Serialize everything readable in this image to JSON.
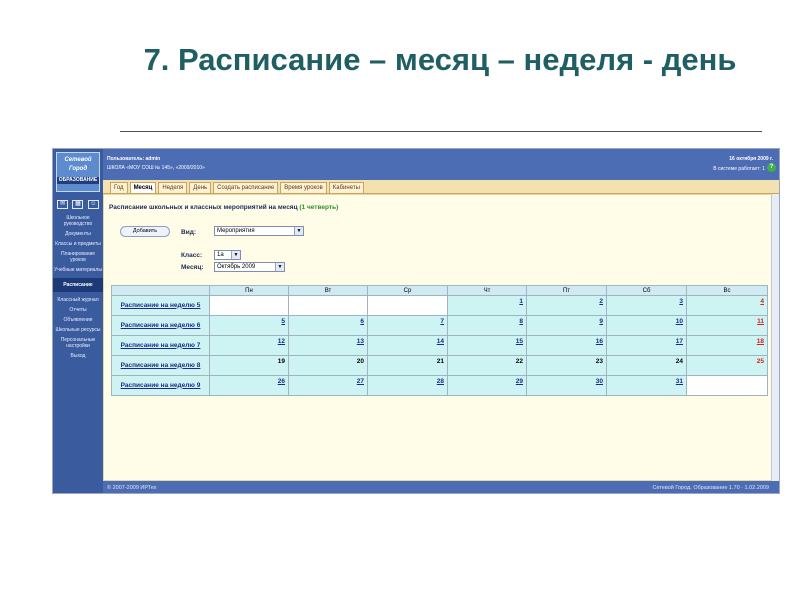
{
  "slide": {
    "title": "7. Расписание – месяц – неделя - день"
  },
  "sidebar": {
    "logo_text": "Сетевой Город",
    "logo_sub": "ОБРАЗОВАНИЕ",
    "items": [
      {
        "label": "Школьное руководство"
      },
      {
        "label": "Документы"
      },
      {
        "label": "Классы и предметы"
      },
      {
        "label": "Планирование уроков"
      },
      {
        "label": "Учебные материалы"
      },
      {
        "label": "Расписание"
      },
      {
        "label": "Классный журнал"
      },
      {
        "label": "Отчеты"
      },
      {
        "label": "Объявления"
      },
      {
        "label": "Школьные ресурсы"
      },
      {
        "label": "Персональные настройки"
      },
      {
        "label": "Выход"
      }
    ]
  },
  "header": {
    "user": "Пользователь: admin",
    "school": "ШКОЛА «МОУ СОШ № 145», «2009/2010»",
    "date": "16 октября 2009 г.",
    "online": "В системе работает: 1",
    "help": "?"
  },
  "tabs": [
    {
      "label": "Год"
    },
    {
      "label": "Месяц"
    },
    {
      "label": "Неделя"
    },
    {
      "label": "День"
    },
    {
      "label": "Создать расписание"
    },
    {
      "label": "Время уроков"
    },
    {
      "label": "Кабинеты"
    }
  ],
  "main": {
    "heading": "Расписание школьных и классных мероприятий на месяц",
    "quarter": "(1 четверть)",
    "add_button": "Добавить",
    "view_label": "Вид:",
    "view_value": "Мероприятия",
    "class_label": "Класс:",
    "class_value": "1а",
    "month_label": "Месяц:",
    "month_value": "Октябрь 2009"
  },
  "calendar": {
    "days": [
      "Пн",
      "Вт",
      "Ср",
      "Чт",
      "Пт",
      "Сб",
      "Вс"
    ],
    "weeks": [
      {
        "label": "Расписание на неделю 5",
        "dates": [
          "",
          "",
          "",
          "1",
          "2",
          "3",
          "4"
        ]
      },
      {
        "label": "Расписание на неделю 6",
        "dates": [
          "5",
          "6",
          "7",
          "8",
          "9",
          "10",
          "11"
        ]
      },
      {
        "label": "Расписание на неделю 7",
        "dates": [
          "12",
          "13",
          "14",
          "15",
          "16",
          "17",
          "18"
        ]
      },
      {
        "label": "Расписание на неделю 8",
        "dates": [
          "19",
          "20",
          "21",
          "22",
          "23",
          "24",
          "25"
        ]
      },
      {
        "label": "Расписание на неделю 9",
        "dates": [
          "26",
          "27",
          "28",
          "29",
          "30",
          "31",
          ""
        ]
      }
    ]
  },
  "footer": {
    "left": "© 2007-2009 ИРТех",
    "right": "Сетевой Город. Образование 1.70 · 1.02.2009"
  }
}
